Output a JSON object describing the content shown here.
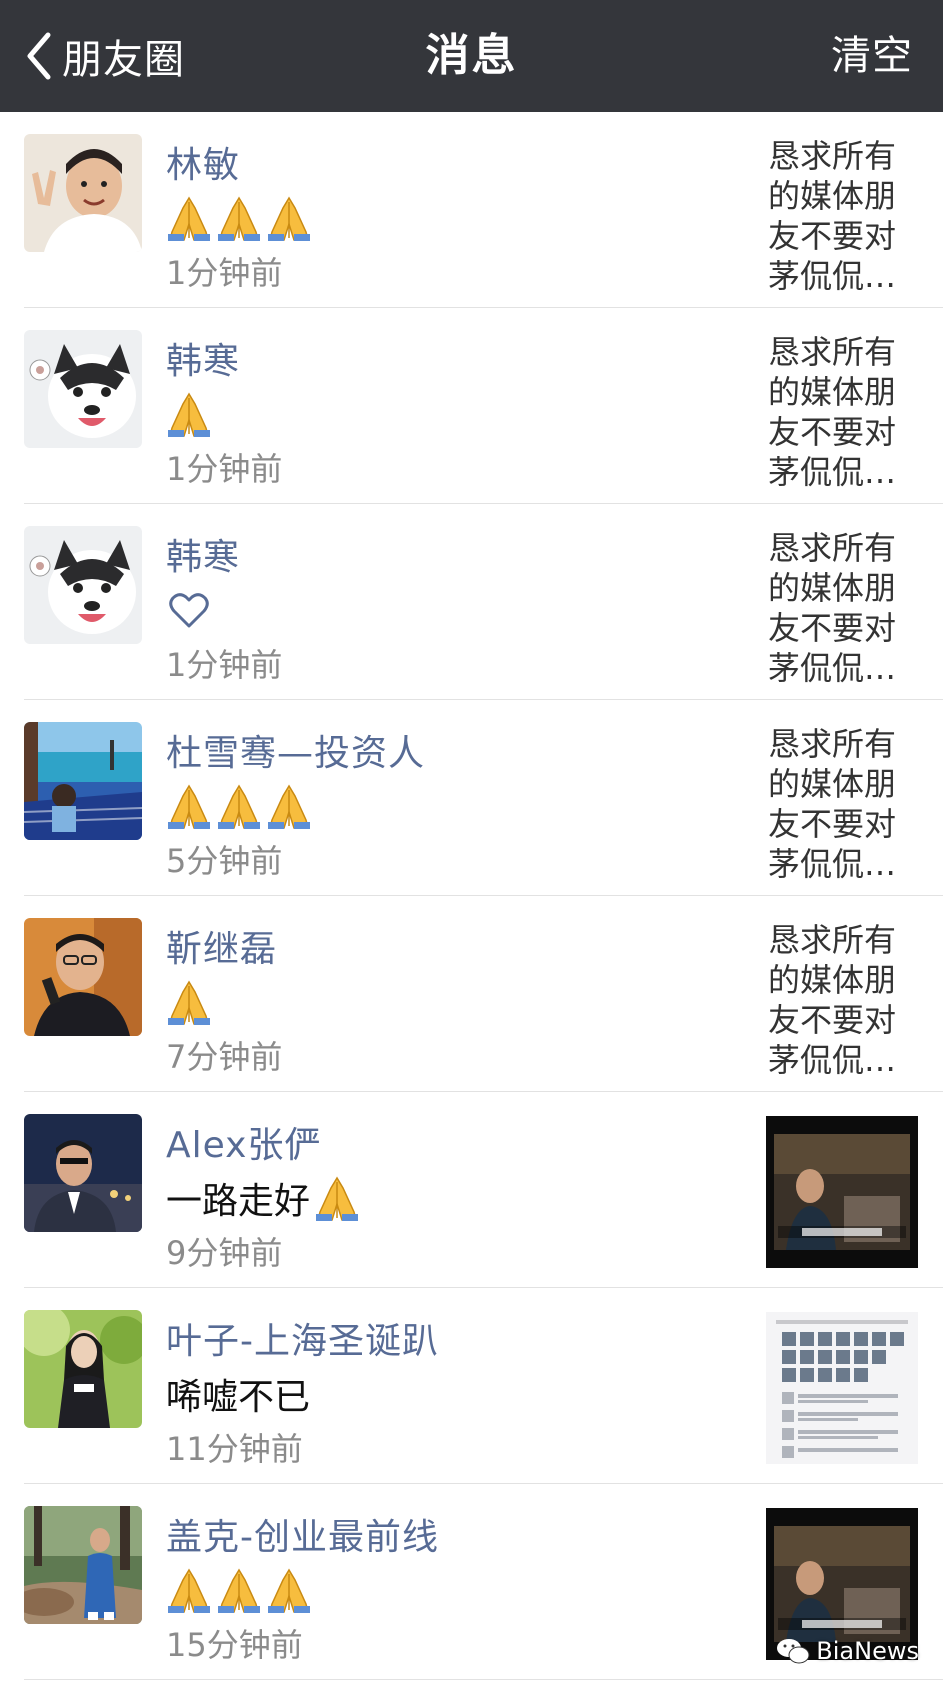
{
  "navbar": {
    "back_label": "朋友圈",
    "title": "消息",
    "action_label": "清空"
  },
  "messages": [
    {
      "name": "林敏",
      "content_type": "pray",
      "pray_count": 3,
      "time": "1分钟前",
      "snippet": "恳求所有的媒体朋友不要对茅侃侃…"
    },
    {
      "name": "韩寒",
      "content_type": "pray",
      "pray_count": 1,
      "time": "1分钟前",
      "snippet": "恳求所有的媒体朋友不要对茅侃侃…"
    },
    {
      "name": "韩寒",
      "content_type": "like",
      "time": "1分钟前",
      "snippet": "恳求所有的媒体朋友不要对茅侃侃…"
    },
    {
      "name": "杜雪骞—投资人",
      "content_type": "pray",
      "pray_count": 3,
      "time": "5分钟前",
      "snippet": "恳求所有的媒体朋友不要对茅侃侃…"
    },
    {
      "name": "靳继磊",
      "content_type": "pray",
      "pray_count": 1,
      "time": "7分钟前",
      "snippet": "恳求所有的媒体朋友不要对茅侃侃…"
    },
    {
      "name": "Alex张俨",
      "content_type": "text",
      "text": "一路走好",
      "pray_count": 1,
      "time": "9分钟前",
      "thumbnail": "video-screenshot"
    },
    {
      "name": "叶子-上海圣诞趴",
      "content_type": "text",
      "text": "唏嘘不已",
      "pray_count": 0,
      "time": "11分钟前",
      "thumbnail": "chat-screenshot"
    },
    {
      "name": "盖克-创业最前线",
      "content_type": "pray",
      "pray_count": 3,
      "time": "15分钟前",
      "thumbnail": "video-screenshot"
    }
  ],
  "watermark": {
    "text": "BiaNews",
    "icon": "wechat-icon"
  },
  "colors": {
    "navbar_bg": "#34363b",
    "name_link": "#576b95",
    "time_gray": "#8b8b8b"
  }
}
